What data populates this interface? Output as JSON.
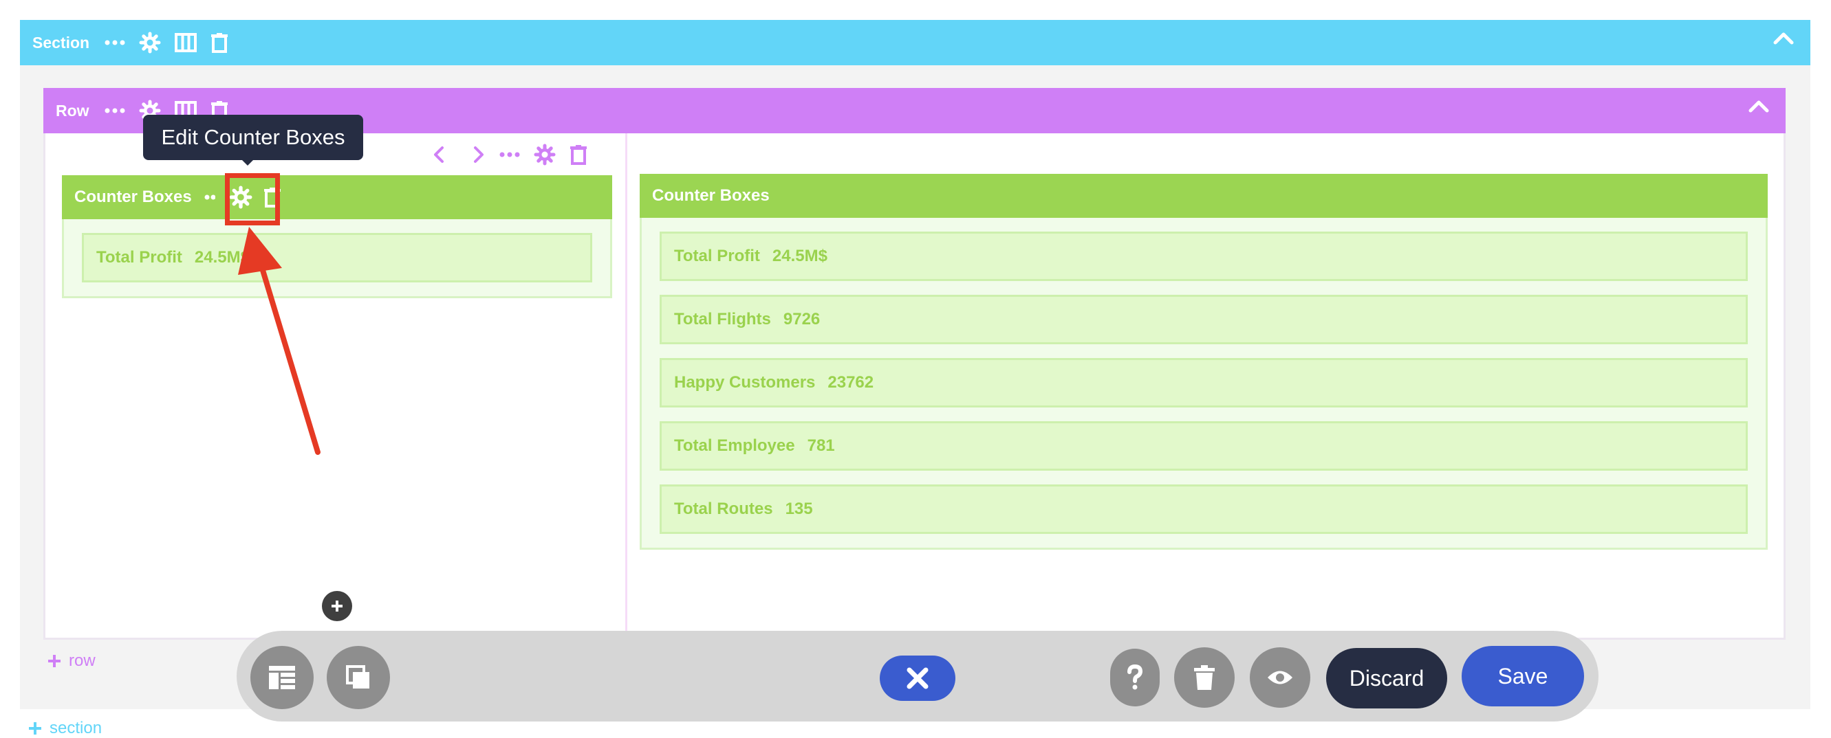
{
  "section": {
    "label": "Section",
    "add_label": "section"
  },
  "row": {
    "label": "Row",
    "add_label": "row"
  },
  "tooltip": {
    "text": "Edit Counter Boxes"
  },
  "modules": {
    "left": {
      "title": "Counter Boxes",
      "items": [
        {
          "label": "Total Profit",
          "value": "24.5M$"
        }
      ]
    },
    "right": {
      "title": "Counter Boxes",
      "items": [
        {
          "label": "Total Profit",
          "value": "24.5M$"
        },
        {
          "label": "Total Flights",
          "value": "9726"
        },
        {
          "label": "Happy Customers",
          "value": "23762"
        },
        {
          "label": "Total Employee",
          "value": "781"
        },
        {
          "label": "Total Routes",
          "value": "135"
        }
      ]
    }
  },
  "toolbar": {
    "discard_label": "Discard",
    "save_label": "Save"
  },
  "colors": {
    "section": "#62d5f8",
    "row": "#cf7ff6",
    "module": "#9bd552",
    "tooltip": "#262d43",
    "primary": "#3a5ccf",
    "annotation": "#e53a24"
  },
  "icons": [
    "more-icon",
    "gear-icon",
    "columns-icon",
    "trash-icon",
    "chevron-up-icon",
    "chevron-left-icon",
    "chevron-right-icon",
    "plus-icon",
    "layout-icon",
    "layers-icon",
    "close-icon",
    "help-icon",
    "eye-icon"
  ]
}
